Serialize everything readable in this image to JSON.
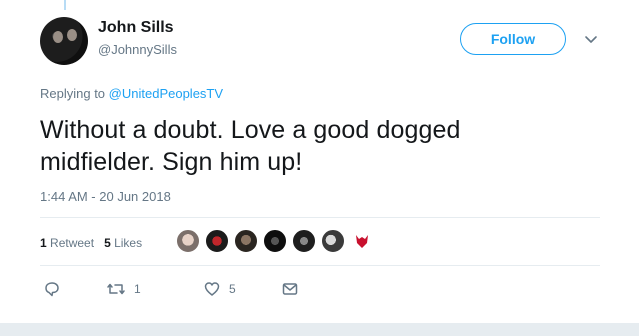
{
  "author": {
    "name": "John Sills",
    "handle": "@JohnnySills"
  },
  "follow_label": "Follow",
  "reply": {
    "prefix": "Replying to",
    "mention": "@UnitedPeoplesTV"
  },
  "tweet": {
    "text_line1": "Without a doubt. Love a good dogged",
    "text_line2": "midfielder. Sign him up!",
    "timestamp": "1:44 AM - 20 Jun 2018"
  },
  "stats": {
    "retweets_count": "1",
    "retweets_label": "Retweet",
    "likes_count": "5",
    "likes_label": "Likes"
  },
  "actions": {
    "reply_count": "",
    "retweet_count": "1",
    "like_count": "5"
  },
  "colors": {
    "accent": "#1da1f2",
    "muted": "#657786",
    "divider": "#e6ecf0"
  }
}
